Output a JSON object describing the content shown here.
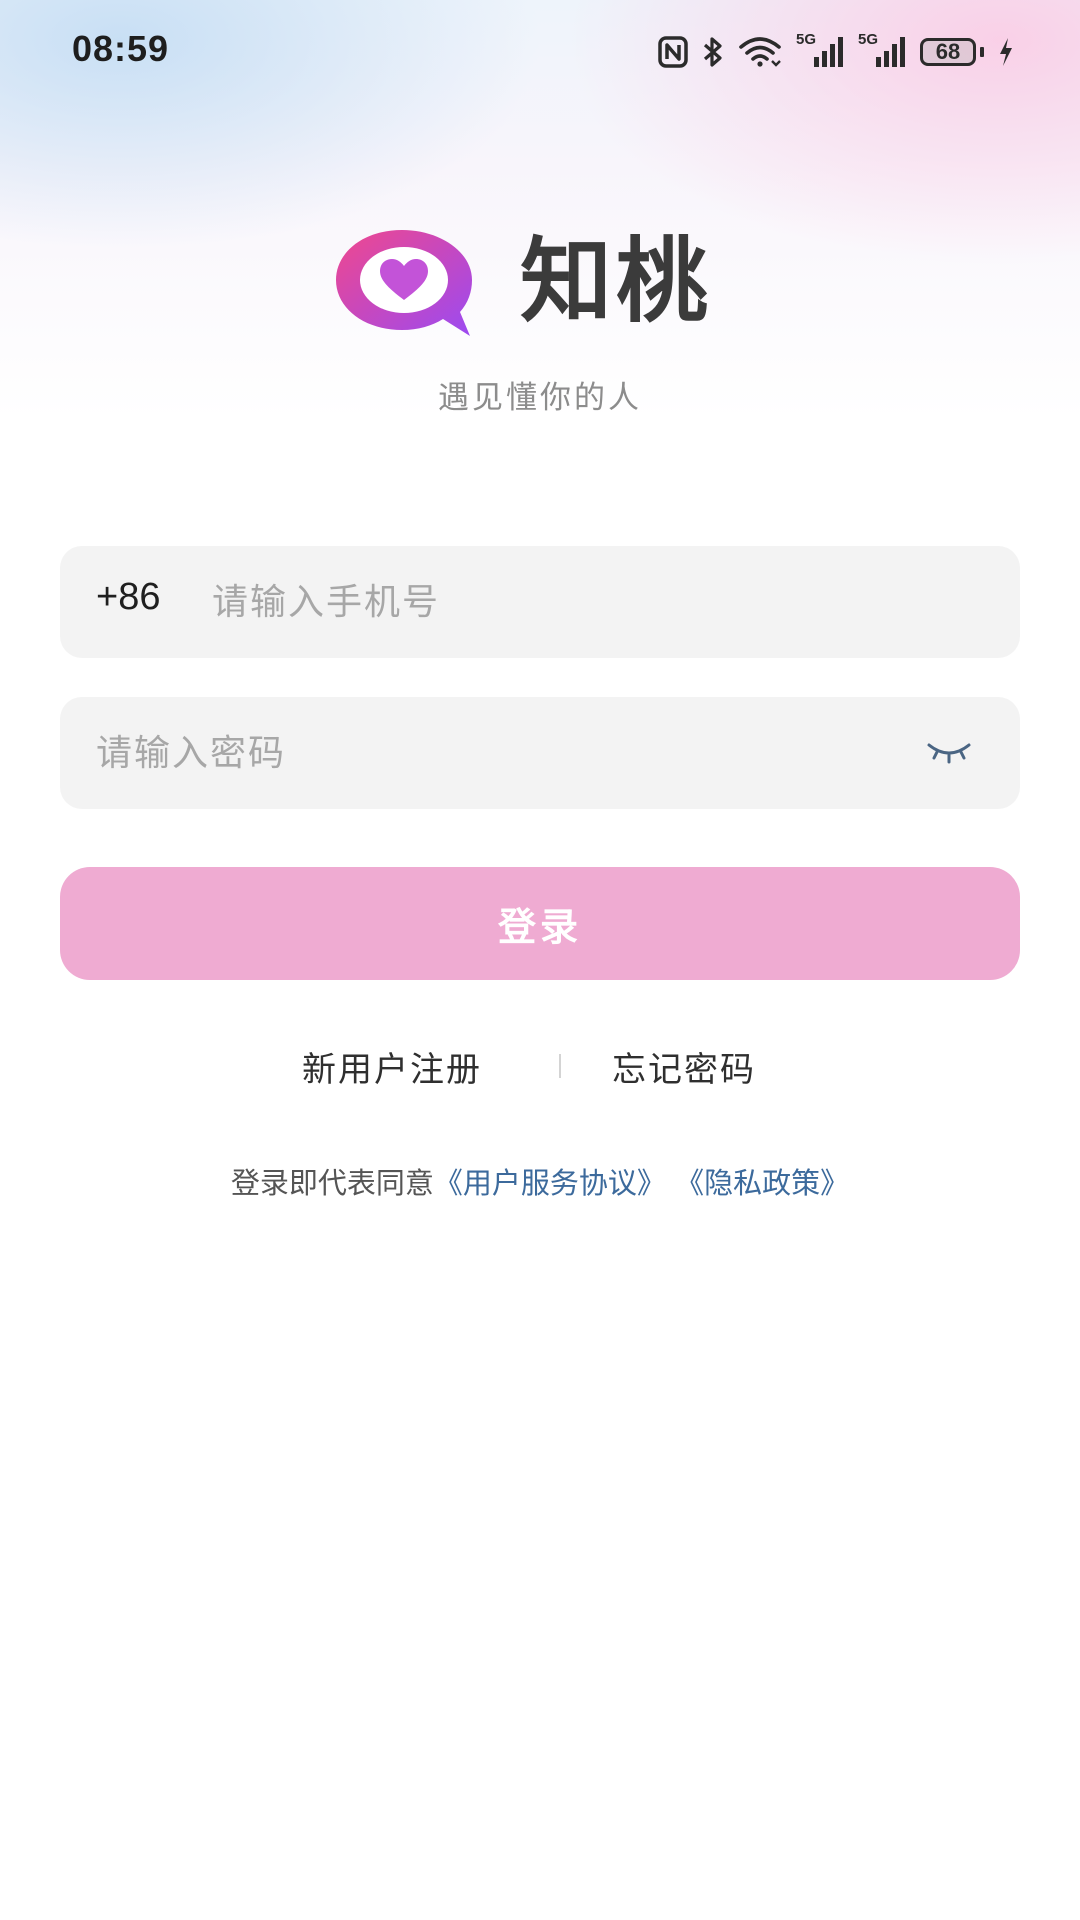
{
  "status_bar": {
    "time": "08:59",
    "network_tag_1": "5G",
    "network_tag_2": "5G",
    "battery_level": "68",
    "icons": [
      "nfc-icon",
      "bluetooth-icon",
      "wifi-icon",
      "signal-5g-icon",
      "signal-5g-icon",
      "battery-icon",
      "charging-icon"
    ]
  },
  "brand": {
    "app_name": "知桃",
    "slogan": "遇见懂你的人",
    "logo_icon": "heart-chat-bubble-icon",
    "colors": {
      "logo_start": "#f0478d",
      "logo_end": "#9b4af2",
      "heart": "#c353d8"
    }
  },
  "login_form": {
    "country_code": "+86",
    "phone_placeholder": "请输入手机号",
    "phone_value": "",
    "password_placeholder": "请输入密码",
    "password_value": "",
    "toggle_visibility_icon": "eye-closed-icon",
    "submit_label": "登录",
    "submit_color": "#efabd2"
  },
  "links": {
    "register": "新用户注册",
    "forgot_password": "忘记密码"
  },
  "agreement": {
    "prefix": "登录即代表同意",
    "terms": "《用户服务协议》",
    "privacy": "《隐私政策》",
    "link_color": "#3c6a9c"
  }
}
